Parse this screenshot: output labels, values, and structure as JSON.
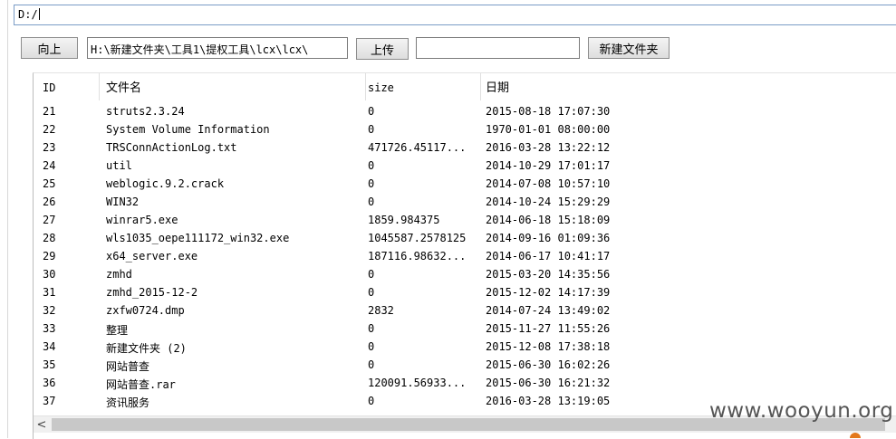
{
  "path_bar": {
    "value": "D:/"
  },
  "toolbar": {
    "up_label": "向上",
    "path_value": "H:\\新建文件夹\\工具1\\提权工具\\lcx\\lcx\\",
    "upload_label": "上传",
    "folder_name_value": "",
    "new_folder_label": "新建文件夹"
  },
  "file_list": {
    "headers": {
      "id": "ID",
      "name": "文件名",
      "size": "size",
      "date": "日期"
    },
    "rows": [
      {
        "id": "21",
        "name": "struts2.3.24",
        "size": "0",
        "date": "2015-08-18 17:07:30"
      },
      {
        "id": "22",
        "name": "System Volume Information",
        "size": "0",
        "date": "1970-01-01 08:00:00"
      },
      {
        "id": "23",
        "name": "TRSConnActionLog.txt",
        "size": "471726.45117...",
        "date": "2016-03-28 13:22:12"
      },
      {
        "id": "24",
        "name": "util",
        "size": "0",
        "date": "2014-10-29 17:01:17"
      },
      {
        "id": "25",
        "name": "weblogic.9.2.crack",
        "size": "0",
        "date": "2014-07-08 10:57:10"
      },
      {
        "id": "26",
        "name": "WIN32",
        "size": "0",
        "date": "2014-10-24 15:29:29"
      },
      {
        "id": "27",
        "name": "winrar5.exe",
        "size": "1859.984375",
        "date": "2014-06-18 15:18:09"
      },
      {
        "id": "28",
        "name": "wls1035_oepe111172_win32.exe",
        "size": "1045587.2578125",
        "date": "2014-09-16 01:09:36"
      },
      {
        "id": "29",
        "name": "x64_server.exe",
        "size": "187116.98632...",
        "date": "2014-06-17 10:41:17"
      },
      {
        "id": "30",
        "name": "zmhd",
        "size": "0",
        "date": "2015-03-20 14:35:56"
      },
      {
        "id": "31",
        "name": "zmhd_2015-12-2",
        "size": "0",
        "date": "2015-12-02 14:17:39"
      },
      {
        "id": "32",
        "name": "zxfw0724.dmp",
        "size": "2832",
        "date": "2014-07-24 13:49:02"
      },
      {
        "id": "33",
        "name": "整理",
        "size": "0",
        "date": "2015-11-27 11:55:26"
      },
      {
        "id": "34",
        "name": "新建文件夹 (2)",
        "size": "0",
        "date": "2015-12-08 17:38:18"
      },
      {
        "id": "35",
        "name": "网站普查",
        "size": "0",
        "date": "2015-06-30 16:02:26"
      },
      {
        "id": "36",
        "name": "网站普查.rar",
        "size": "120091.56933...",
        "date": "2015-06-30 16:21:32"
      },
      {
        "id": "37",
        "name": "资讯服务",
        "size": "0",
        "date": "2016-03-28 13:19:05"
      }
    ]
  },
  "scrollbar": {
    "left_arrow": "<"
  },
  "watermark": "www.wooyun.org",
  "icons": {
    "scroll_left": "chevron-left-icon"
  }
}
